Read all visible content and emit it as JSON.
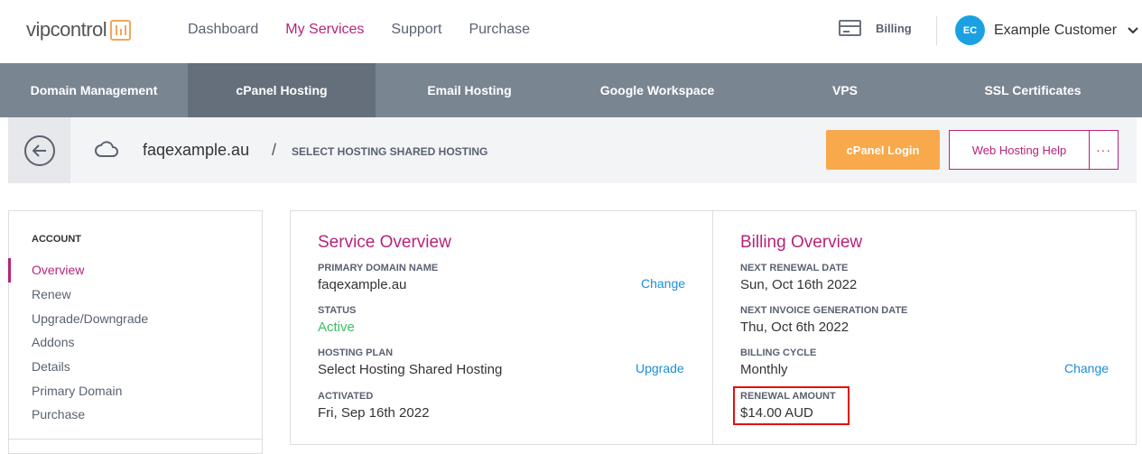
{
  "header": {
    "logo": {
      "text_a": "vip",
      "text_b": "control"
    },
    "nav": [
      {
        "label": "Dashboard",
        "active": false
      },
      {
        "label": "My Services",
        "active": true
      },
      {
        "label": "Support",
        "active": false
      },
      {
        "label": "Purchase",
        "active": false
      }
    ],
    "billing_label": "Billing",
    "user": {
      "initials": "EC",
      "name": "Example Customer"
    }
  },
  "subnav": [
    {
      "label": "Domain Management",
      "active": false
    },
    {
      "label": "cPanel Hosting",
      "active": true
    },
    {
      "label": "Email Hosting",
      "active": false
    },
    {
      "label": "Google Workspace",
      "active": false
    },
    {
      "label": "VPS",
      "active": false
    },
    {
      "label": "SSL Certificates",
      "active": false
    }
  ],
  "breadcrumb": {
    "domain": "faqexample.au",
    "separator": "/",
    "plan": "SELECT HOSTING SHARED HOSTING"
  },
  "actions": {
    "login_label": "cPanel Login",
    "help_label": "Web Hosting Help",
    "more_label": "···"
  },
  "sidebar": {
    "heading": "ACCOUNT",
    "items": [
      {
        "label": "Overview",
        "active": true
      },
      {
        "label": "Renew"
      },
      {
        "label": "Upgrade/Downgrade"
      },
      {
        "label": "Addons"
      },
      {
        "label": "Details"
      },
      {
        "label": "Primary Domain"
      },
      {
        "label": "Purchase"
      }
    ]
  },
  "service": {
    "title": "Service Overview",
    "primary_domain_label": "PRIMARY DOMAIN NAME",
    "primary_domain": "faqexample.au",
    "change_label": "Change",
    "status_label": "STATUS",
    "status": "Active",
    "plan_label": "HOSTING PLAN",
    "plan": "Select Hosting Shared Hosting",
    "upgrade_label": "Upgrade",
    "activated_label": "ACTIVATED",
    "activated": "Fri, Sep 16th 2022"
  },
  "billing": {
    "title": "Billing Overview",
    "renewal_date_label": "NEXT RENEWAL DATE",
    "renewal_date": "Sun, Oct 16th 2022",
    "invoice_date_label": "NEXT INVOICE GENERATION DATE",
    "invoice_date": "Thu, Oct 6th 2022",
    "cycle_label": "BILLING CYCLE",
    "cycle": "Monthly",
    "change_label": "Change",
    "amount_label": "RENEWAL AMOUNT",
    "amount": "$14.00 AUD"
  },
  "colors": {
    "brand": "#b5247a",
    "accent": "#f7a94c",
    "link": "#1a8fd6",
    "active_status": "#3bbf63",
    "highlight": "#e01010"
  }
}
